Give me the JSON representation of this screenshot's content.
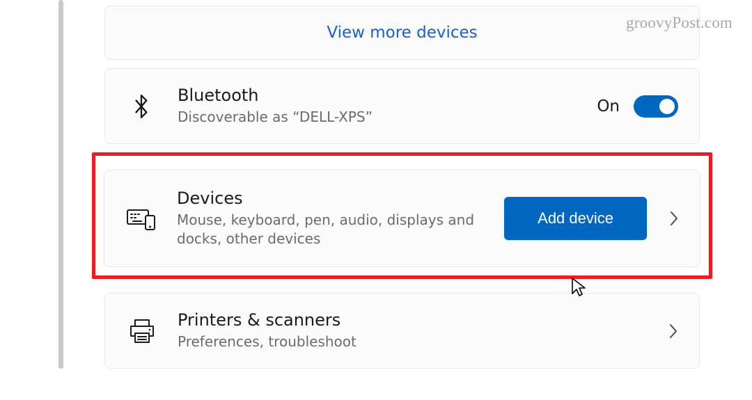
{
  "watermark": "groovyPost.com",
  "view_more": {
    "label": "View more devices"
  },
  "bluetooth": {
    "title": "Bluetooth",
    "subtitle": "Discoverable as “DELL-XPS”",
    "state_label": "On"
  },
  "devices": {
    "title": "Devices",
    "subtitle": "Mouse, keyboard, pen, audio, displays and docks, other devices",
    "button_label": "Add device"
  },
  "printers": {
    "title": "Printers & scanners",
    "subtitle": "Preferences, troubleshoot"
  },
  "colors": {
    "accent": "#0067c0",
    "highlight": "#ec1c24"
  }
}
